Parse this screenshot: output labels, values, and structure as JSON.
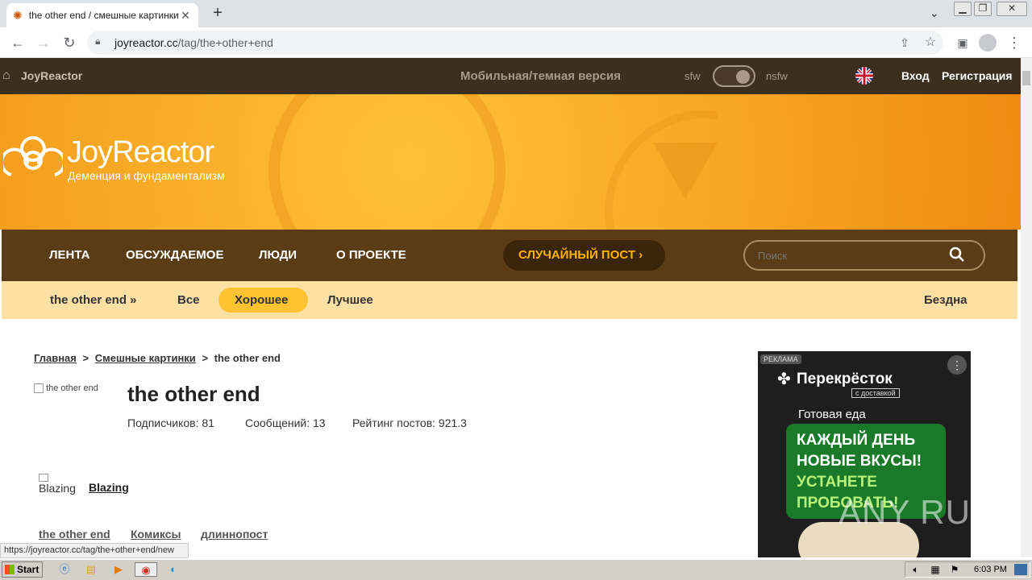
{
  "browser": {
    "tab_title": "the other end / смешные картинки",
    "url_host": "joyreactor.cc",
    "url_path": "/tag/the+other+end",
    "status_url": "https://joyreactor.cc/tag/the+other+end/new"
  },
  "topbar": {
    "brand": "JoyReactor",
    "mobile_link": "Мобильная/темная версия",
    "sfw": "sfw",
    "nsfw": "nsfw",
    "login": "Вход",
    "register": "Регистрация"
  },
  "hero": {
    "title": "JoyReactor",
    "subtitle": "Деменция и фундаментализм"
  },
  "mainnav": {
    "items": [
      "ЛЕНТА",
      "ОБСУЖДАЕМОЕ",
      "ЛЮДИ",
      "О ПРОЕКТЕ"
    ],
    "random": "СЛУЧАЙНЫЙ ПОСТ",
    "search_placeholder": "Поиск"
  },
  "subnav": {
    "tag": "the other end »",
    "all": "Все",
    "good": "Хорошее",
    "best": "Лучшее",
    "abyss": "Бездна"
  },
  "breadcrumb": {
    "home": "Главная",
    "category": "Смешные картинки",
    "current": "the other end",
    "sep": ">"
  },
  "tag": {
    "img_alt": "the other end",
    "title": "the other end",
    "subscribers": "Подписчиков: 81",
    "posts": "Сообщений: 13",
    "rating": "Рейтинг постов: 921.3"
  },
  "post": {
    "author_img_alt": "Blazing",
    "author": "Blazing",
    "tags": [
      "the other end",
      "Комиксы",
      "длиннопост"
    ]
  },
  "ad": {
    "label": "РЕКЛАМА",
    "brand": "Перекрёсток",
    "brand_sub": "с доставкой",
    "line1": "Готовая еда",
    "promo1": "КАЖДЫЙ ДЕНЬ",
    "promo2": "НОВЫЕ ВКУСЫ!",
    "promo3": "УСТАНЕТЕ",
    "promo4": "ПРОБОВАТЬ!"
  },
  "watermark": "ANY RUN",
  "taskbar": {
    "start": "Start",
    "clock": "6:03 PM"
  }
}
